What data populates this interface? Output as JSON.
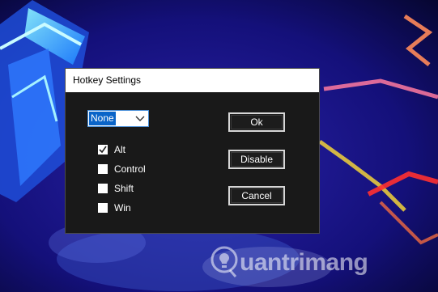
{
  "dialog": {
    "title": "Hotkey Settings",
    "key_select": {
      "selected": "None"
    },
    "modifiers": [
      {
        "label": "Alt",
        "checked": true
      },
      {
        "label": "Control",
        "checked": false
      },
      {
        "label": "Shift",
        "checked": false
      },
      {
        "label": "Win",
        "checked": false
      }
    ],
    "buttons": {
      "ok": "Ok",
      "disable": "Disable",
      "cancel": "Cancel"
    }
  },
  "watermark": {
    "text": "uantrimang"
  },
  "colors": {
    "dialog_bg": "#191919",
    "titlebar_bg": "#ffffff",
    "selection_bg": "#0a64c8",
    "button_border": "#d6d6d6"
  }
}
